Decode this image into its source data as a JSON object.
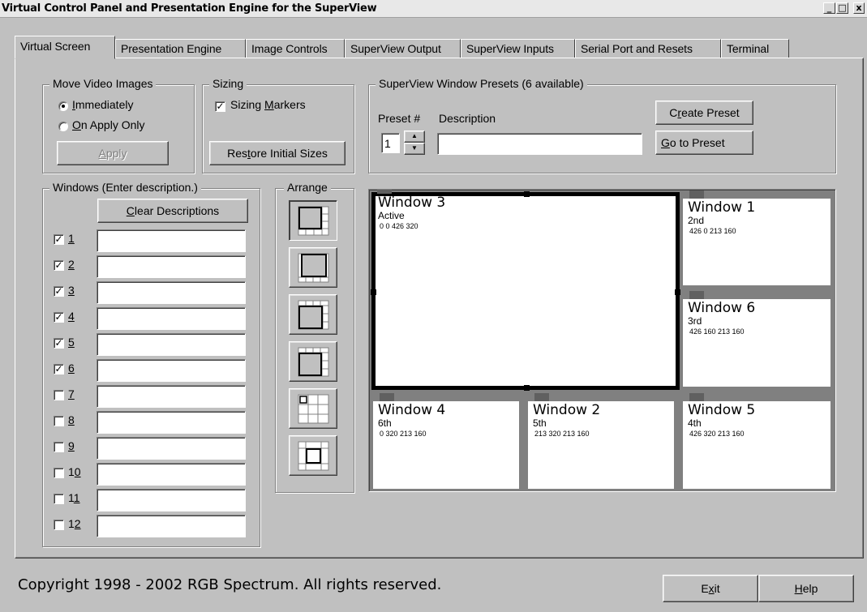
{
  "window": {
    "title": "Virtual Control Panel and Presentation Engine for the SuperView",
    "controls": [
      "_",
      "□",
      "x"
    ]
  },
  "tabs": [
    {
      "label": "Virtual Screen",
      "active": true
    },
    {
      "label": "Presentation Engine"
    },
    {
      "label": "Image Controls"
    },
    {
      "label": "SuperView Output"
    },
    {
      "label": "SuperView Inputs"
    },
    {
      "label": "Serial Port and Resets"
    },
    {
      "label": "Terminal"
    }
  ],
  "move_video": {
    "legend": "Move Video Images",
    "immediately": {
      "pre": "",
      "key": "I",
      "post": "mmediately",
      "selected": true
    },
    "on_apply": {
      "pre": "",
      "key": "O",
      "post": "n Apply Only",
      "selected": false
    },
    "apply": {
      "pre": "",
      "key": "A",
      "post": "pply",
      "disabled": true
    }
  },
  "sizing": {
    "legend": "Sizing",
    "markers": {
      "pre": "Sizing ",
      "key": "M",
      "post": "arkers",
      "checked": true
    },
    "restore": {
      "pre": "Res",
      "key": "t",
      "post": "ore Initial Sizes"
    }
  },
  "presets": {
    "legend": "SuperView Window Presets (6 available)",
    "preset_label": "Preset #",
    "description_label": "Description",
    "preset_value": "1",
    "description_value": "",
    "create": {
      "pre": "C",
      "key": "r",
      "post": "eate Preset"
    },
    "goto": {
      "pre": "",
      "key": "G",
      "post": "o to Preset"
    }
  },
  "windows_group": {
    "legend": "Windows (Enter description.)",
    "clear": {
      "pre": "",
      "key": "C",
      "post": "lear Descriptions"
    },
    "items": [
      {
        "pre": "",
        "key": "1",
        "post": "",
        "checked": true,
        "value": ""
      },
      {
        "pre": "",
        "key": "2",
        "post": "",
        "checked": true,
        "value": ""
      },
      {
        "pre": "",
        "key": "3",
        "post": "",
        "checked": true,
        "value": ""
      },
      {
        "pre": "",
        "key": "4",
        "post": "",
        "checked": true,
        "value": ""
      },
      {
        "pre": "",
        "key": "5",
        "post": "",
        "checked": true,
        "value": ""
      },
      {
        "pre": "",
        "key": "6",
        "post": "",
        "checked": true,
        "value": ""
      },
      {
        "pre": "",
        "key": "7",
        "post": "",
        "checked": false,
        "value": ""
      },
      {
        "pre": "",
        "key": "8",
        "post": "",
        "checked": false,
        "value": ""
      },
      {
        "pre": "",
        "key": "9",
        "post": "",
        "checked": false,
        "value": ""
      },
      {
        "pre": "1",
        "key": "0",
        "post": "",
        "checked": false,
        "value": ""
      },
      {
        "pre": "1",
        "key": "1",
        "post": "",
        "checked": false,
        "value": ""
      },
      {
        "pre": "1",
        "key": "2",
        "post": "",
        "checked": false,
        "value": ""
      }
    ]
  },
  "arrange": {
    "legend": "Arrange",
    "buttons": [
      "arrange-large-left-icon",
      "arrange-large-top-icon",
      "arrange-large-bottom-left-icon",
      "arrange-large-top-left-icon",
      "arrange-grid-icon",
      "arrange-center-icon"
    ]
  },
  "virtual_screen": {
    "windows": [
      {
        "name": "Window 3",
        "state": "Active",
        "geometry": "0 0 426 320",
        "active": true
      },
      {
        "name": "Window 1",
        "state": "2nd",
        "geometry": "426 0 213 160"
      },
      {
        "name": "Window 6",
        "state": "3rd",
        "geometry": "426 160 213 160"
      },
      {
        "name": "Window 4",
        "state": "6th",
        "geometry": "0 320 213 160"
      },
      {
        "name": "Window 2",
        "state": "5th",
        "geometry": "213 320 213 160"
      },
      {
        "name": "Window 5",
        "state": "4th",
        "geometry": "426 320 213 160"
      }
    ]
  },
  "footer": {
    "copyright": "Copyright 1998 - 2002 RGB Spectrum.  All rights reserved.",
    "exit": {
      "pre": "E",
      "key": "x",
      "post": "it"
    },
    "help": {
      "pre": "",
      "key": "H",
      "post": "elp"
    }
  }
}
